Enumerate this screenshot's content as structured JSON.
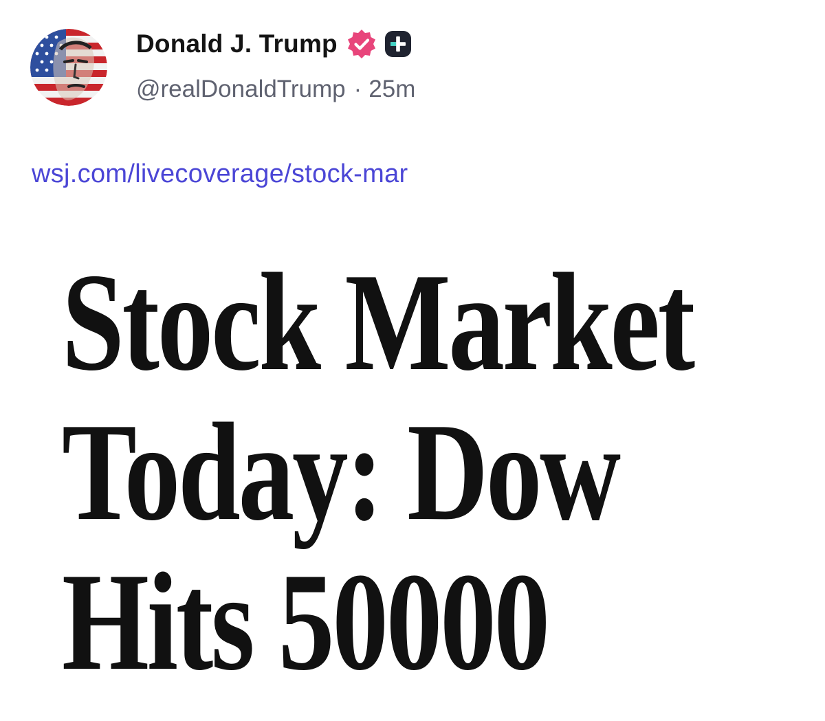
{
  "post": {
    "author": {
      "display_name": "Donald J. Trump",
      "handle": "@realDonaldTrump",
      "verified_icon": "verified-badge-icon",
      "plus_icon": "plus-badge-icon",
      "avatar": "profile-avatar"
    },
    "separator": "·",
    "timestamp": "25m",
    "link_text": "wsj.com/livecoverage/stock-mar",
    "card": {
      "headline_lines": [
        "Stock Market",
        "Today: Dow",
        "Hits 50000"
      ]
    }
  },
  "colors": {
    "link": "#4b46d6",
    "verified": "#e8457b",
    "meta_text": "#5f6270",
    "plus_badge": "#1f2330"
  }
}
